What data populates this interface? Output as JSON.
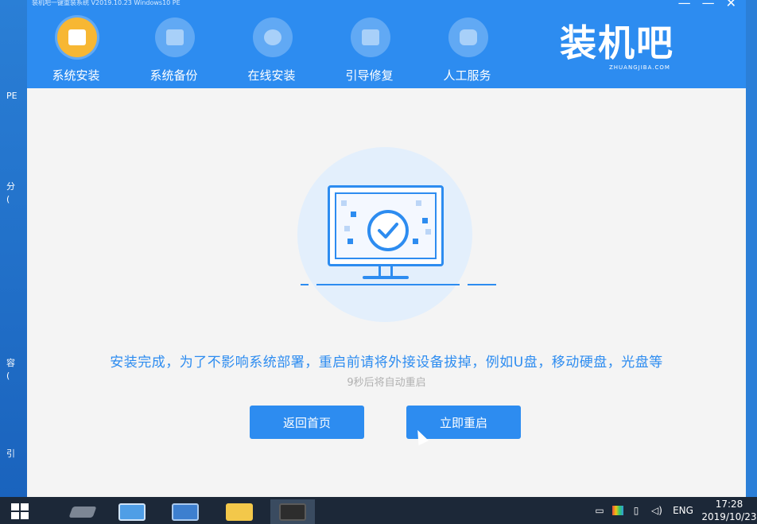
{
  "app": {
    "title_strip": "装机吧一键重装系统  V2019.10.23  Windows10 PE",
    "controls": [
      "—",
      "—",
      "✕"
    ],
    "nav": [
      {
        "label": "系统安装",
        "icon": "system-install-icon",
        "active": true
      },
      {
        "label": "系统备份",
        "icon": "backup-icon",
        "active": false
      },
      {
        "label": "在线安装",
        "icon": "download-icon",
        "active": false
      },
      {
        "label": "引导修复",
        "icon": "toolbox-icon",
        "active": false
      },
      {
        "label": "人工服务",
        "icon": "chat-icon",
        "active": false
      }
    ],
    "logo_text": "装机吧",
    "logo_url": "ZHUANGJIBA.COM"
  },
  "desktop_left_labels": [
    "PE",
    "分",
    "(",
    "容",
    "(",
    "引"
  ],
  "content": {
    "message": "安装完成，为了不影响系统部署，重启前请将外接设备拔掉，例如U盘，移动硬盘，光盘等",
    "countdown": "9秒后将自动重启",
    "btn_home": "返回首页",
    "btn_restart": "立即重启"
  },
  "taskbar": {
    "lang": "ENG",
    "time": "17:28",
    "date": "2019/10/23"
  },
  "colors": {
    "primary": "#2d8cf0",
    "active_nav": "#f7b733",
    "taskbar": "#1c2838"
  }
}
